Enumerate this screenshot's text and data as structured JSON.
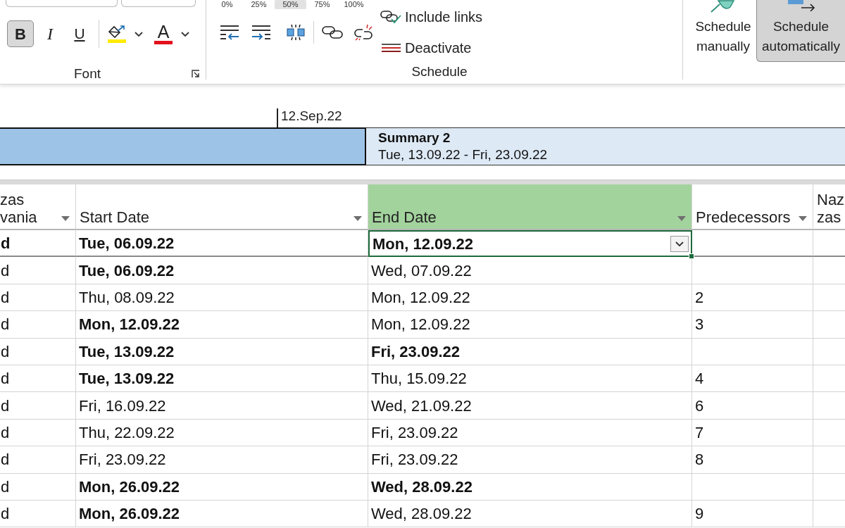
{
  "ribbon": {
    "font_group": {
      "label": "Font",
      "styles": [
        {
          "kind": "bold",
          "label": "B",
          "selected": true
        },
        {
          "kind": "italic",
          "label": "I",
          "selected": false
        },
        {
          "kind": "underline",
          "label": "U",
          "selected": false
        }
      ],
      "fill_color": {
        "color": "#ffeb00"
      },
      "font_color": {
        "label": "A",
        "color": "#e3101b"
      }
    },
    "schedule_group": {
      "label": "Schedule",
      "mark_on_track": [
        {
          "label": "0%",
          "selected": false
        },
        {
          "label": "25%",
          "selected": false
        },
        {
          "label": "50%",
          "selected": true
        },
        {
          "label": "75%",
          "selected": false
        },
        {
          "label": "100%",
          "selected": false
        }
      ],
      "commands": [
        {
          "kind": "link",
          "label": "Include links"
        },
        {
          "kind": "deactivate",
          "label": "Deactivate"
        }
      ]
    },
    "mode_buttons": [
      {
        "kind": "manual",
        "label": "Schedule manually",
        "selected": false
      },
      {
        "kind": "auto",
        "label": "Schedule automatically",
        "selected": true
      }
    ]
  },
  "timeline": {
    "date_marker": "12.Sep.22",
    "bars": [
      {
        "selected": true
      },
      {
        "selected": false,
        "title": "Summary 2",
        "dates": "Tue, 13.09.22 - Fri, 23.09.22"
      }
    ]
  },
  "table": {
    "columns": [
      {
        "lines": [
          "zas",
          "vania"
        ],
        "filter": true,
        "selected": false
      },
      {
        "lines": [
          "Start Date"
        ],
        "filter": true,
        "selected": false
      },
      {
        "lines": [
          "End Date"
        ],
        "filter": true,
        "selected": true
      },
      {
        "lines": [
          "Predecessors"
        ],
        "filter": true,
        "selected": false
      },
      {
        "lines": [
          "Naz",
          "zas"
        ],
        "selected": false
      }
    ],
    "rows": [
      {
        "cells": [
          {
            "text": "d",
            "bold": true,
            "selected": false
          },
          {
            "text": "Tue, 06.09.22",
            "bold": true,
            "selected": false
          },
          {
            "text": "Mon, 12.09.22",
            "bold": true,
            "selected": true
          },
          {
            "selected": false
          },
          {
            "selected": false
          }
        ]
      },
      {
        "cells": [
          {
            "text": "d",
            "bold": false,
            "selected": false
          },
          {
            "text": "Tue, 06.09.22",
            "bold": true,
            "selected": false
          },
          {
            "text": "Wed, 07.09.22",
            "bold": false,
            "selected": false
          },
          {
            "selected": false
          },
          {
            "selected": false
          }
        ]
      },
      {
        "cells": [
          {
            "text": "d",
            "bold": false,
            "selected": false
          },
          {
            "text": "Thu, 08.09.22",
            "bold": false,
            "selected": false
          },
          {
            "text": "Mon, 12.09.22",
            "bold": false,
            "selected": false
          },
          {
            "text": "2",
            "bold": false,
            "selected": false
          },
          {
            "selected": false
          }
        ]
      },
      {
        "cells": [
          {
            "text": "d",
            "bold": false,
            "selected": false
          },
          {
            "text": "Mon, 12.09.22",
            "bold": true,
            "selected": false
          },
          {
            "text": "Mon, 12.09.22",
            "bold": false,
            "selected": false
          },
          {
            "text": "3",
            "bold": false,
            "selected": false
          },
          {
            "selected": false
          }
        ]
      },
      {
        "cells": [
          {
            "text": "d",
            "bold": false,
            "selected": false
          },
          {
            "text": "Tue, 13.09.22",
            "bold": true,
            "selected": false
          },
          {
            "text": "Fri, 23.09.22",
            "bold": true,
            "selected": false
          },
          {
            "selected": false
          },
          {
            "selected": false
          }
        ]
      },
      {
        "cells": [
          {
            "text": "d",
            "bold": false,
            "selected": false
          },
          {
            "text": "Tue, 13.09.22",
            "bold": true,
            "selected": false
          },
          {
            "text": "Thu, 15.09.22",
            "bold": false,
            "selected": false
          },
          {
            "text": "4",
            "bold": false,
            "selected": false
          },
          {
            "selected": false
          }
        ]
      },
      {
        "cells": [
          {
            "text": "d",
            "bold": false,
            "selected": false
          },
          {
            "text": "Fri, 16.09.22",
            "bold": false,
            "selected": false
          },
          {
            "text": "Wed, 21.09.22",
            "bold": false,
            "selected": false
          },
          {
            "text": "6",
            "bold": false,
            "selected": false
          },
          {
            "selected": false
          }
        ]
      },
      {
        "cells": [
          {
            "text": "d",
            "bold": false,
            "selected": false
          },
          {
            "text": "Thu, 22.09.22",
            "bold": false,
            "selected": false
          },
          {
            "text": "Fri, 23.09.22",
            "bold": false,
            "selected": false
          },
          {
            "text": "7",
            "bold": false,
            "selected": false
          },
          {
            "selected": false
          }
        ]
      },
      {
        "cells": [
          {
            "text": "d",
            "bold": false,
            "selected": false
          },
          {
            "text": "Fri, 23.09.22",
            "bold": false,
            "selected": false
          },
          {
            "text": "Fri, 23.09.22",
            "bold": false,
            "selected": false
          },
          {
            "text": "8",
            "bold": false,
            "selected": false
          },
          {
            "selected": false
          }
        ]
      },
      {
        "cells": [
          {
            "text": "d",
            "bold": false,
            "selected": false
          },
          {
            "text": "Mon, 26.09.22",
            "bold": true,
            "selected": false
          },
          {
            "text": "Wed, 28.09.22",
            "bold": true,
            "selected": false
          },
          {
            "selected": false
          },
          {
            "selected": false
          }
        ]
      },
      {
        "cells": [
          {
            "text": "d",
            "bold": false,
            "selected": false
          },
          {
            "text": "Mon, 26.09.22",
            "bold": true,
            "selected": false
          },
          {
            "text": "Wed, 28.09.22",
            "bold": false,
            "selected": false
          },
          {
            "text": "9",
            "bold": false,
            "selected": false
          },
          {
            "selected": false
          }
        ]
      }
    ]
  }
}
